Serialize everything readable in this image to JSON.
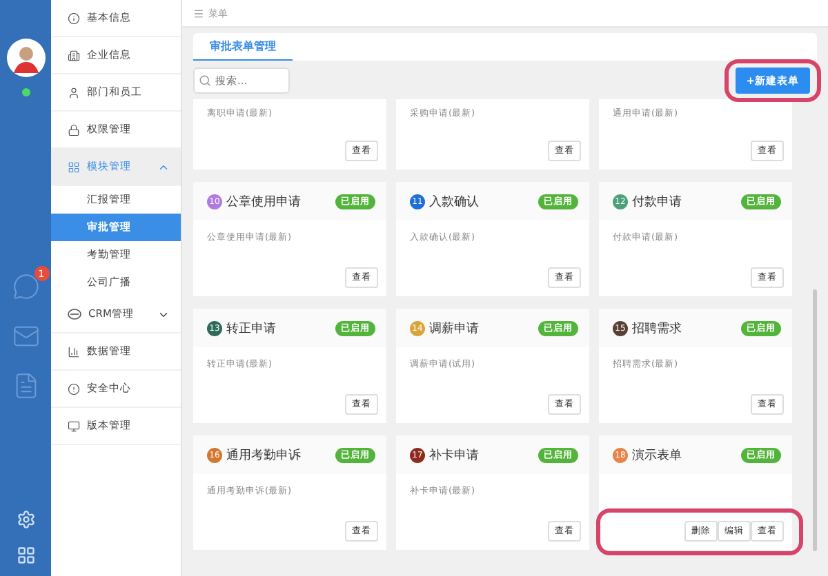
{
  "rail": {
    "online": true,
    "chat_badge": "1"
  },
  "nav": [
    {
      "kind": "item",
      "label": "基本信息"
    },
    {
      "kind": "item",
      "label": "企业信息"
    },
    {
      "kind": "item",
      "label": "部门和员工"
    },
    {
      "kind": "item",
      "label": "权限管理"
    },
    {
      "kind": "group",
      "label": "模块管理",
      "expanded": true,
      "selected": true,
      "children": [
        {
          "label": "汇报管理",
          "selected": false
        },
        {
          "label": "审批管理",
          "selected": true
        },
        {
          "label": "考勤管理",
          "selected": false
        },
        {
          "label": "公司广播",
          "selected": false
        }
      ]
    },
    {
      "kind": "group",
      "label": "CRM管理",
      "expanded": false,
      "selected": false
    },
    {
      "kind": "item",
      "label": "数据管理"
    },
    {
      "kind": "item",
      "label": "安全中心"
    },
    {
      "kind": "item",
      "label": "版本管理"
    }
  ],
  "header": {
    "menu_label": "菜单"
  },
  "tabs": [
    {
      "label": "审批表单管理",
      "selected": true
    }
  ],
  "search": {
    "placeholder": "搜索..."
  },
  "new_button": {
    "label": "+新建表单",
    "highlighted": true
  },
  "cards": [
    {
      "description": "离职申请(最新)",
      "actions": [
        {
          "label": "查看"
        }
      ]
    },
    {
      "description": "采购申请(最新)",
      "actions": [
        {
          "label": "查看"
        }
      ]
    },
    {
      "description": "通用申请(最新)",
      "actions": [
        {
          "label": "查看"
        }
      ]
    },
    {
      "number": "10",
      "color": "#b07be0",
      "title": "公章使用申请",
      "status": "已启用",
      "description": "公章使用申请(最新)",
      "actions": [
        {
          "label": "查看"
        }
      ]
    },
    {
      "number": "11",
      "color": "#1e6fd9",
      "title": "入款确认",
      "status": "已启用",
      "description": "入款确认(最新)",
      "actions": [
        {
          "label": "查看"
        }
      ]
    },
    {
      "number": "12",
      "color": "#4ca07a",
      "title": "付款申请",
      "status": "已启用",
      "description": "付款申请(最新)",
      "actions": [
        {
          "label": "查看"
        }
      ]
    },
    {
      "number": "13",
      "color": "#2e6b5a",
      "title": "转正申请",
      "status": "已启用",
      "description": "转正申请(最新)",
      "actions": [
        {
          "label": "查看"
        }
      ]
    },
    {
      "number": "14",
      "color": "#d9a53a",
      "title": "调薪申请",
      "status": "已启用",
      "description": "调薪申请(试用)",
      "actions": [
        {
          "label": "查看"
        }
      ]
    },
    {
      "number": "15",
      "color": "#5a4033",
      "title": "招聘需求",
      "status": "已启用",
      "description": "招聘需求(最新)",
      "actions": [
        {
          "label": "查看"
        }
      ]
    },
    {
      "number": "16",
      "color": "#d2772e",
      "title": "通用考勤申诉",
      "status": "已启用",
      "description": "通用考勤申诉(最新)",
      "actions": [
        {
          "label": "查看"
        }
      ]
    },
    {
      "number": "17",
      "color": "#8e2a1e",
      "title": "补卡申请",
      "status": "已启用",
      "description": "补卡申请(最新)",
      "actions": [
        {
          "label": "查看"
        }
      ]
    },
    {
      "number": "18",
      "color": "#e8834a",
      "title": "演示表单",
      "status": "已启用",
      "actions_highlighted": true,
      "actions": [
        {
          "label": "删除"
        },
        {
          "label": "编辑"
        },
        {
          "label": "查看"
        }
      ]
    }
  ]
}
